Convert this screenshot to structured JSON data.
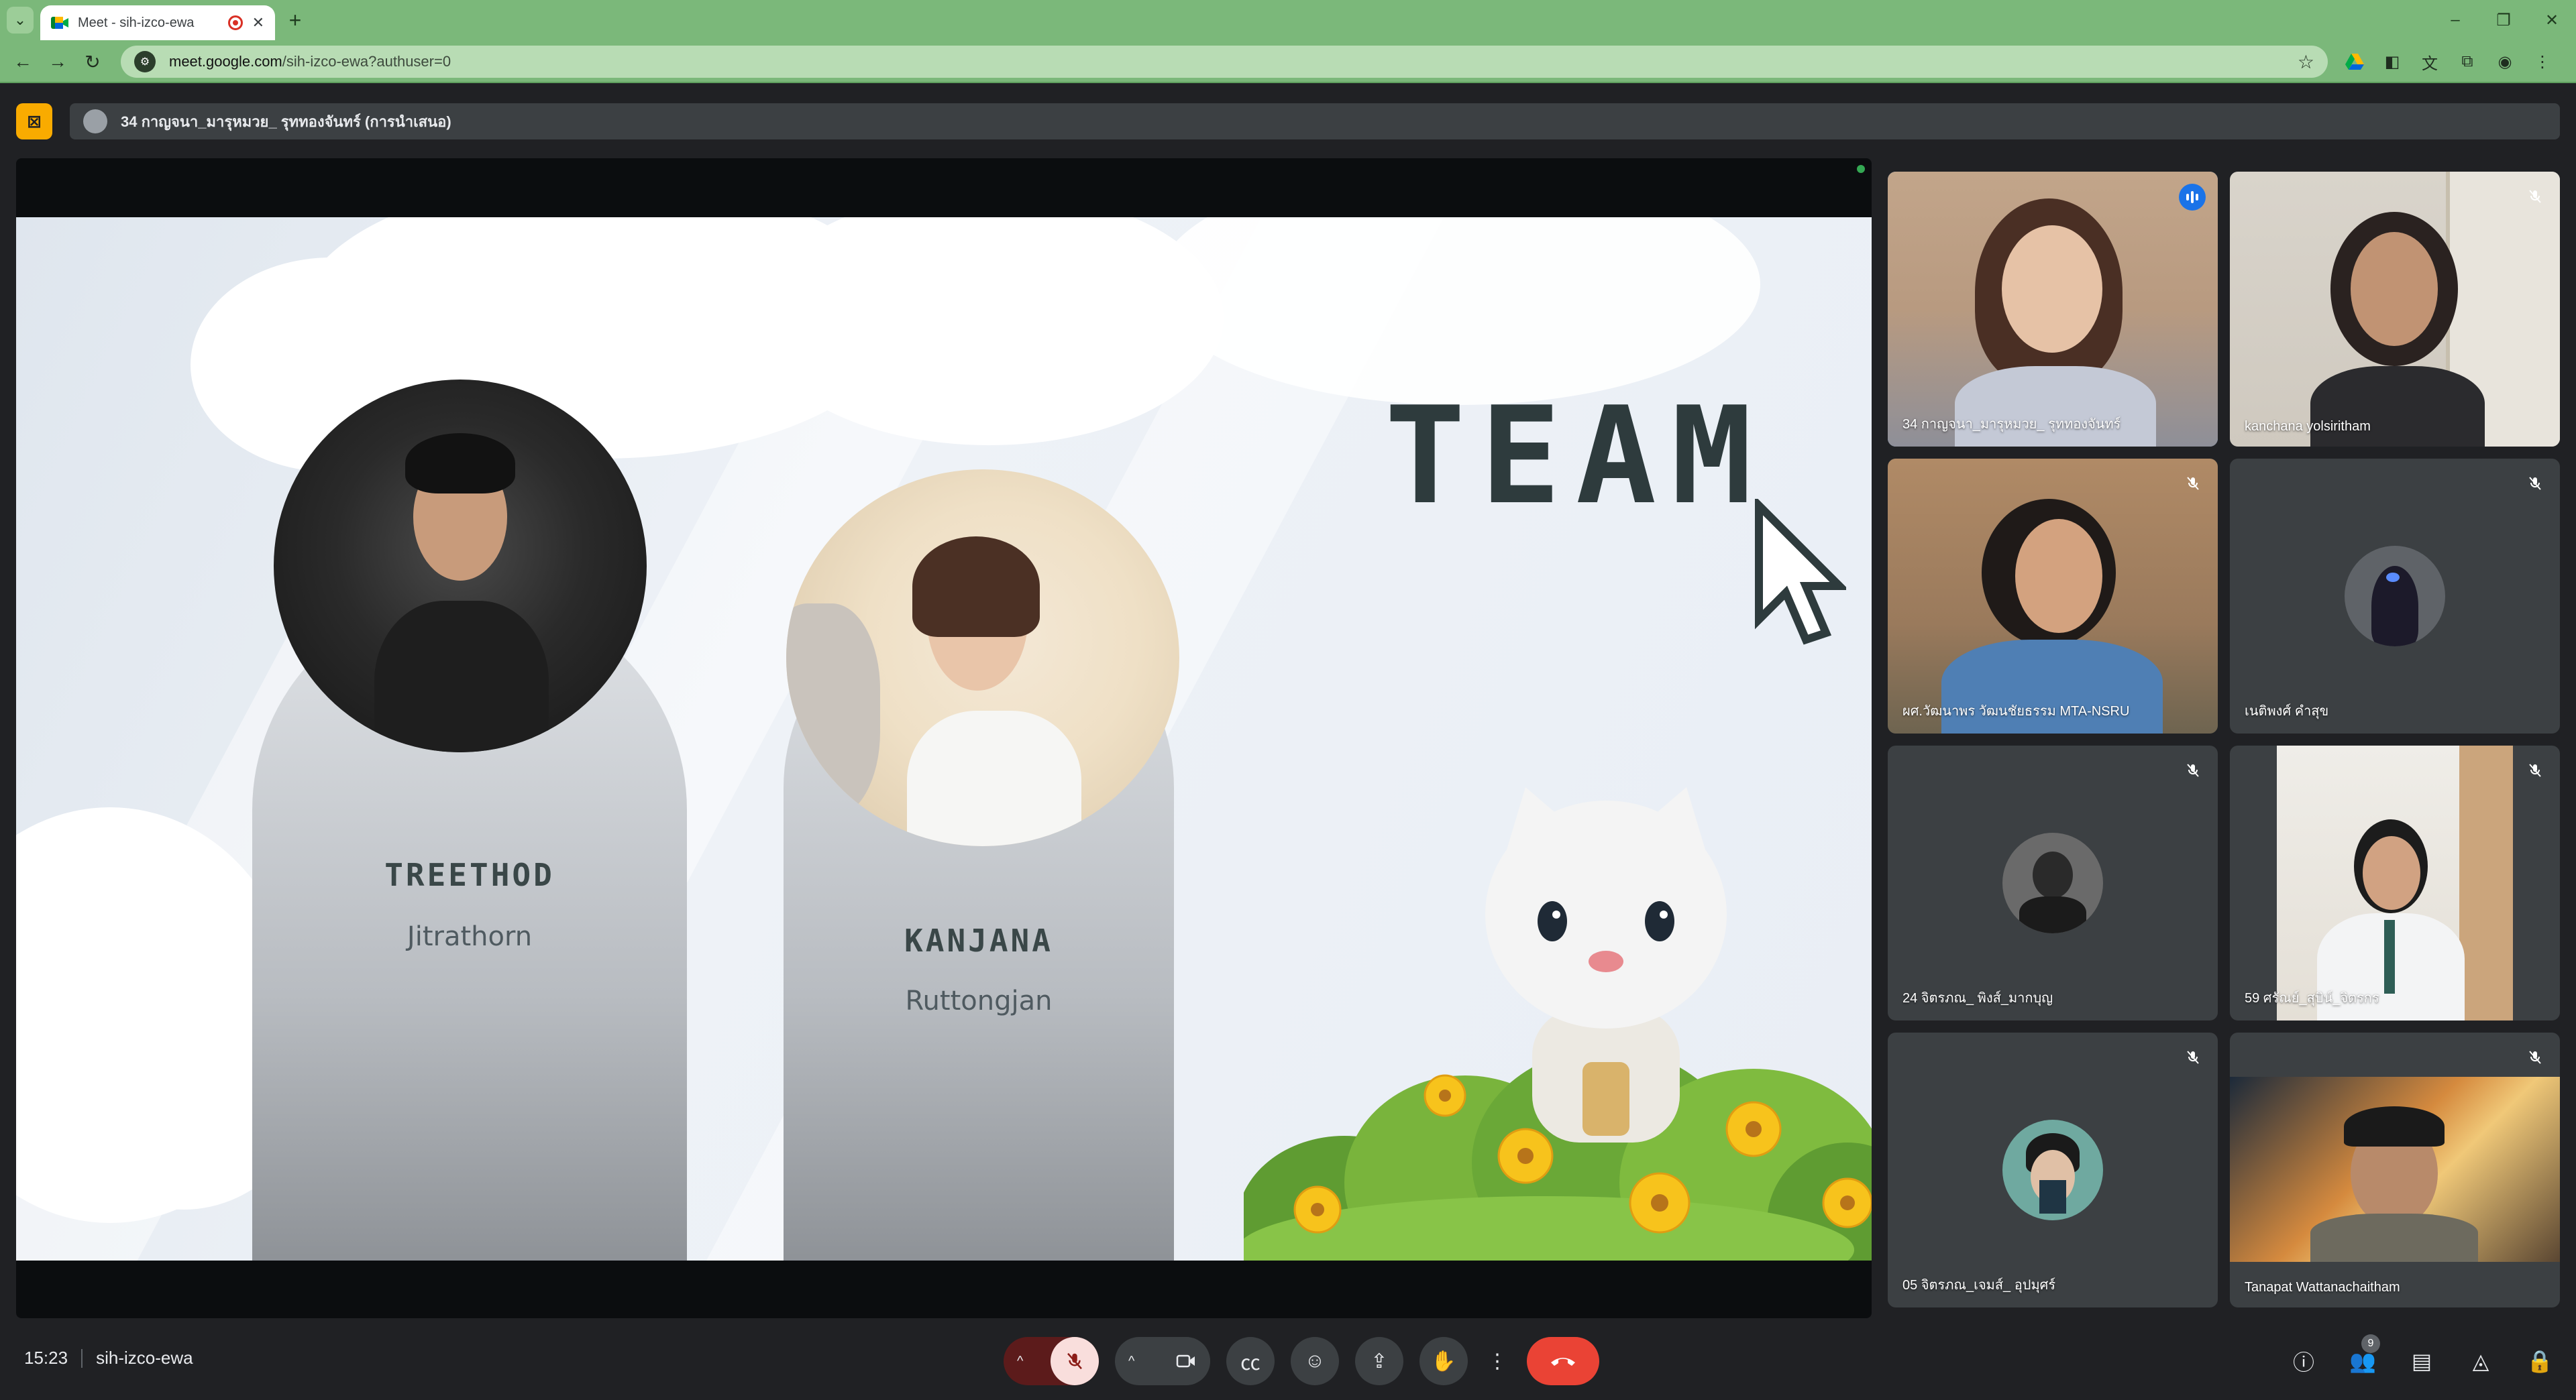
{
  "browser": {
    "tab_title": "Meet - sih-izco-ewa",
    "url_host": "meet.google.com",
    "url_path": "/sih-izco-ewa?authuser=0"
  },
  "presenting": {
    "label": "34 กาญจนา_มารุหมวย_ รุททองจันทร์ (การนำเสนอ)"
  },
  "slide": {
    "title": "TEAM",
    "members": [
      {
        "first": "TREETHOD",
        "last": "Jitrathorn"
      },
      {
        "first": "KANJANA",
        "last": "Ruttongjan"
      }
    ]
  },
  "participants": [
    {
      "name": "34 กาญจนา_มารุหมวย_ รุททองจันทร์",
      "state": "speaking"
    },
    {
      "name": "kanchana yolsiritham",
      "state": "muted"
    },
    {
      "name": "ผศ.วัฒนาพร วัฒนชัยธรรม MTA-NSRU",
      "state": "muted"
    },
    {
      "name": "เนติพงศ์ คำสุข",
      "state": "muted"
    },
    {
      "name": "24 จิตรภณ_ พิงส์_มากบุญ",
      "state": "muted"
    },
    {
      "name": "59 ศรัณย์_สุบิน์_จิตรกร",
      "state": "muted"
    },
    {
      "name": "05 จิตรภณ_เจมส์_ อุปมุศร์",
      "state": "muted"
    },
    {
      "name": "Tanapat Wattanachaitham",
      "state": "muted"
    }
  ],
  "controls": {
    "time": "15:23",
    "meeting_code": "sih-izco-ewa",
    "people_count": "9"
  },
  "colors": {
    "accent_blue": "#1a73e8",
    "hangup_red": "#ea4335",
    "present_yellow": "#f9ab00",
    "browser_green": "#7bb87a"
  }
}
